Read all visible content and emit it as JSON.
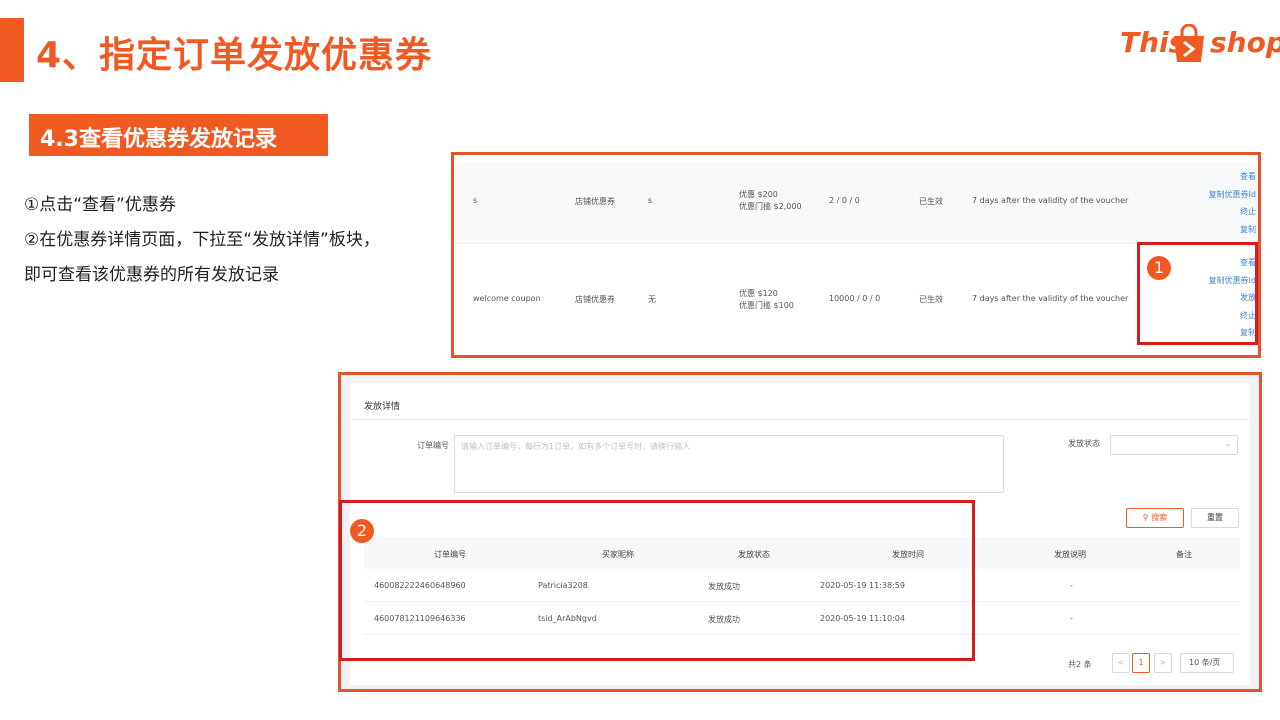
{
  "header": {
    "title": "4、指定订单发放优惠券",
    "logo": {
      "part1": "This",
      "part2": "shop"
    }
  },
  "section": {
    "label": "4.3查看优惠券发放记录"
  },
  "instructions": [
    "①点击“查看”优惠券",
    "②在优惠券详情页面，下拉至“发放详情”板块，",
    "即可查看该优惠券的所有发放记录"
  ],
  "coupon_list": {
    "rows": [
      {
        "name": "s",
        "type": "店铺优惠券",
        "code": "s",
        "discount": "优惠 $200",
        "threshold": "优惠门槛 $2,000",
        "counts": "2 / 0 / 0",
        "status": "已生效",
        "validity": "7 days after the validity of the voucher",
        "actions": [
          "查看",
          "复制优惠券Id",
          "终止",
          "复制"
        ]
      },
      {
        "name": "welcome coupon",
        "type": "店铺优惠券",
        "code": "无",
        "discount": "优惠 $120",
        "threshold": "优惠门槛 $100",
        "counts": "10000 / 0 / 0",
        "status": "已生效",
        "validity": "7 days after the validity of the voucher",
        "actions": [
          "查看",
          "复制优惠券Id",
          "发放",
          "终止",
          "复制"
        ]
      }
    ]
  },
  "badges": {
    "one": "1",
    "two": "2"
  },
  "issue_details": {
    "title": "发放详情",
    "order_label": "订单编号",
    "order_placeholder": "请输入订单编号，每行为1订单，如有多个订单号时，请换行输入",
    "status_label": "发放状态",
    "search_label": "搜索",
    "reset_label": "重置",
    "columns": [
      "订单编号",
      "买家昵称",
      "发放状态",
      "发放时间",
      "发放说明",
      "备注"
    ],
    "rows": [
      {
        "order_no": "460082222460648960",
        "buyer": "Patricia3208",
        "status": "发放成功",
        "time": "2020-05-19 11:38:59",
        "note": "-"
      },
      {
        "order_no": "460078121109646336",
        "buyer": "tsid_ArAbNgvd",
        "status": "发放成功",
        "time": "2020-05-19 11:10:04",
        "note": "-"
      }
    ],
    "pagination": {
      "total": "共2 条",
      "prev": "<",
      "page": "1",
      "next": ">",
      "size": "10 条/页"
    }
  },
  "colors": {
    "accent": "#f05a22",
    "highlight_box": "#d21e1e",
    "link": "#3a83d8"
  }
}
